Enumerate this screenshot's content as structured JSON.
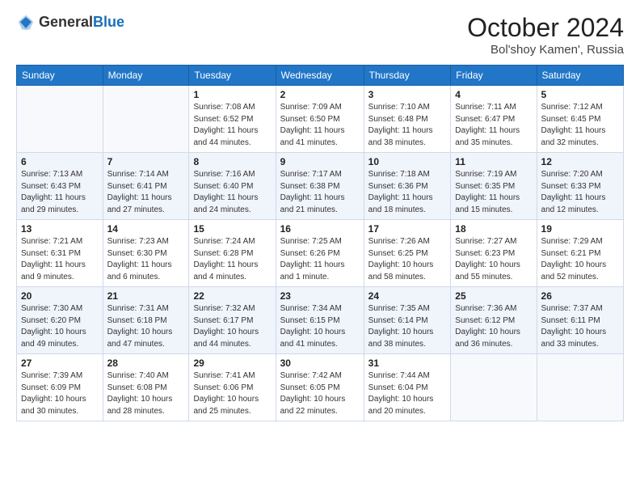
{
  "header": {
    "logo_line1": "General",
    "logo_line2": "Blue",
    "month_title": "October 2024",
    "location": "Bol'shoy Kamen', Russia"
  },
  "days_of_week": [
    "Sunday",
    "Monday",
    "Tuesday",
    "Wednesday",
    "Thursday",
    "Friday",
    "Saturday"
  ],
  "weeks": [
    [
      {
        "day": "",
        "sunrise": "",
        "sunset": "",
        "daylight": ""
      },
      {
        "day": "",
        "sunrise": "",
        "sunset": "",
        "daylight": ""
      },
      {
        "day": "1",
        "sunrise": "Sunrise: 7:08 AM",
        "sunset": "Sunset: 6:52 PM",
        "daylight": "Daylight: 11 hours and 44 minutes."
      },
      {
        "day": "2",
        "sunrise": "Sunrise: 7:09 AM",
        "sunset": "Sunset: 6:50 PM",
        "daylight": "Daylight: 11 hours and 41 minutes."
      },
      {
        "day": "3",
        "sunrise": "Sunrise: 7:10 AM",
        "sunset": "Sunset: 6:48 PM",
        "daylight": "Daylight: 11 hours and 38 minutes."
      },
      {
        "day": "4",
        "sunrise": "Sunrise: 7:11 AM",
        "sunset": "Sunset: 6:47 PM",
        "daylight": "Daylight: 11 hours and 35 minutes."
      },
      {
        "day": "5",
        "sunrise": "Sunrise: 7:12 AM",
        "sunset": "Sunset: 6:45 PM",
        "daylight": "Daylight: 11 hours and 32 minutes."
      }
    ],
    [
      {
        "day": "6",
        "sunrise": "Sunrise: 7:13 AM",
        "sunset": "Sunset: 6:43 PM",
        "daylight": "Daylight: 11 hours and 29 minutes."
      },
      {
        "day": "7",
        "sunrise": "Sunrise: 7:14 AM",
        "sunset": "Sunset: 6:41 PM",
        "daylight": "Daylight: 11 hours and 27 minutes."
      },
      {
        "day": "8",
        "sunrise": "Sunrise: 7:16 AM",
        "sunset": "Sunset: 6:40 PM",
        "daylight": "Daylight: 11 hours and 24 minutes."
      },
      {
        "day": "9",
        "sunrise": "Sunrise: 7:17 AM",
        "sunset": "Sunset: 6:38 PM",
        "daylight": "Daylight: 11 hours and 21 minutes."
      },
      {
        "day": "10",
        "sunrise": "Sunrise: 7:18 AM",
        "sunset": "Sunset: 6:36 PM",
        "daylight": "Daylight: 11 hours and 18 minutes."
      },
      {
        "day": "11",
        "sunrise": "Sunrise: 7:19 AM",
        "sunset": "Sunset: 6:35 PM",
        "daylight": "Daylight: 11 hours and 15 minutes."
      },
      {
        "day": "12",
        "sunrise": "Sunrise: 7:20 AM",
        "sunset": "Sunset: 6:33 PM",
        "daylight": "Daylight: 11 hours and 12 minutes."
      }
    ],
    [
      {
        "day": "13",
        "sunrise": "Sunrise: 7:21 AM",
        "sunset": "Sunset: 6:31 PM",
        "daylight": "Daylight: 11 hours and 9 minutes."
      },
      {
        "day": "14",
        "sunrise": "Sunrise: 7:23 AM",
        "sunset": "Sunset: 6:30 PM",
        "daylight": "Daylight: 11 hours and 6 minutes."
      },
      {
        "day": "15",
        "sunrise": "Sunrise: 7:24 AM",
        "sunset": "Sunset: 6:28 PM",
        "daylight": "Daylight: 11 hours and 4 minutes."
      },
      {
        "day": "16",
        "sunrise": "Sunrise: 7:25 AM",
        "sunset": "Sunset: 6:26 PM",
        "daylight": "Daylight: 11 hours and 1 minute."
      },
      {
        "day": "17",
        "sunrise": "Sunrise: 7:26 AM",
        "sunset": "Sunset: 6:25 PM",
        "daylight": "Daylight: 10 hours and 58 minutes."
      },
      {
        "day": "18",
        "sunrise": "Sunrise: 7:27 AM",
        "sunset": "Sunset: 6:23 PM",
        "daylight": "Daylight: 10 hours and 55 minutes."
      },
      {
        "day": "19",
        "sunrise": "Sunrise: 7:29 AM",
        "sunset": "Sunset: 6:21 PM",
        "daylight": "Daylight: 10 hours and 52 minutes."
      }
    ],
    [
      {
        "day": "20",
        "sunrise": "Sunrise: 7:30 AM",
        "sunset": "Sunset: 6:20 PM",
        "daylight": "Daylight: 10 hours and 49 minutes."
      },
      {
        "day": "21",
        "sunrise": "Sunrise: 7:31 AM",
        "sunset": "Sunset: 6:18 PM",
        "daylight": "Daylight: 10 hours and 47 minutes."
      },
      {
        "day": "22",
        "sunrise": "Sunrise: 7:32 AM",
        "sunset": "Sunset: 6:17 PM",
        "daylight": "Daylight: 10 hours and 44 minutes."
      },
      {
        "day": "23",
        "sunrise": "Sunrise: 7:34 AM",
        "sunset": "Sunset: 6:15 PM",
        "daylight": "Daylight: 10 hours and 41 minutes."
      },
      {
        "day": "24",
        "sunrise": "Sunrise: 7:35 AM",
        "sunset": "Sunset: 6:14 PM",
        "daylight": "Daylight: 10 hours and 38 minutes."
      },
      {
        "day": "25",
        "sunrise": "Sunrise: 7:36 AM",
        "sunset": "Sunset: 6:12 PM",
        "daylight": "Daylight: 10 hours and 36 minutes."
      },
      {
        "day": "26",
        "sunrise": "Sunrise: 7:37 AM",
        "sunset": "Sunset: 6:11 PM",
        "daylight": "Daylight: 10 hours and 33 minutes."
      }
    ],
    [
      {
        "day": "27",
        "sunrise": "Sunrise: 7:39 AM",
        "sunset": "Sunset: 6:09 PM",
        "daylight": "Daylight: 10 hours and 30 minutes."
      },
      {
        "day": "28",
        "sunrise": "Sunrise: 7:40 AM",
        "sunset": "Sunset: 6:08 PM",
        "daylight": "Daylight: 10 hours and 28 minutes."
      },
      {
        "day": "29",
        "sunrise": "Sunrise: 7:41 AM",
        "sunset": "Sunset: 6:06 PM",
        "daylight": "Daylight: 10 hours and 25 minutes."
      },
      {
        "day": "30",
        "sunrise": "Sunrise: 7:42 AM",
        "sunset": "Sunset: 6:05 PM",
        "daylight": "Daylight: 10 hours and 22 minutes."
      },
      {
        "day": "31",
        "sunrise": "Sunrise: 7:44 AM",
        "sunset": "Sunset: 6:04 PM",
        "daylight": "Daylight: 10 hours and 20 minutes."
      },
      {
        "day": "",
        "sunrise": "",
        "sunset": "",
        "daylight": ""
      },
      {
        "day": "",
        "sunrise": "",
        "sunset": "",
        "daylight": ""
      }
    ]
  ]
}
